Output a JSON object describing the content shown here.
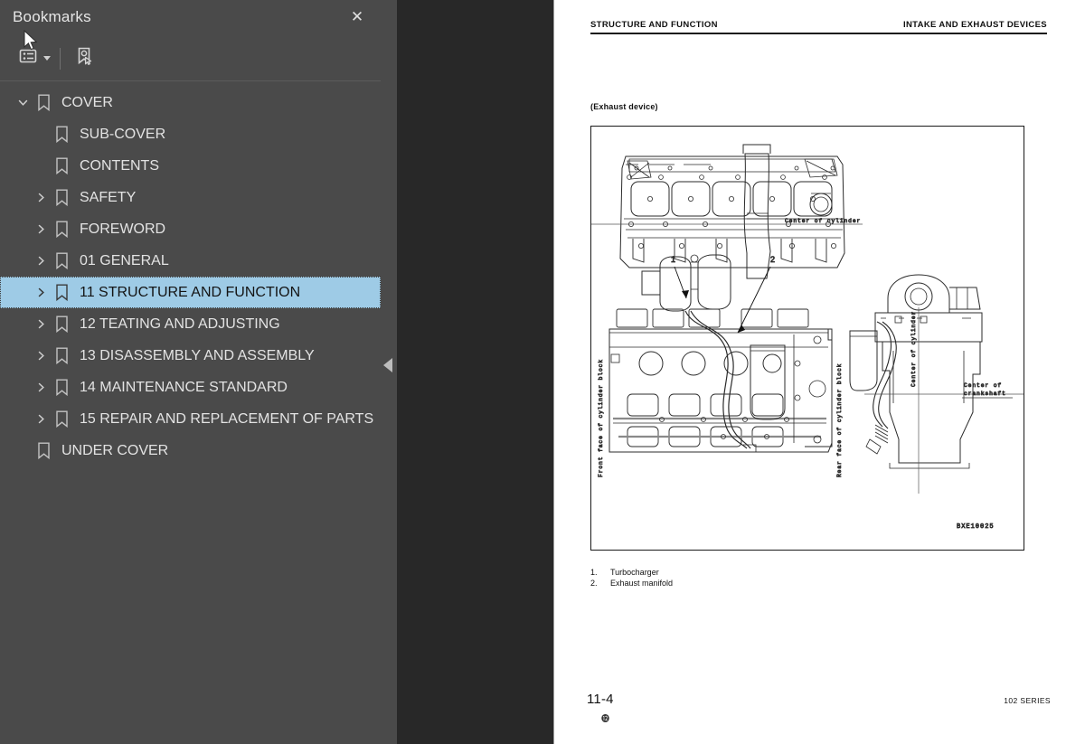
{
  "sidebar": {
    "title": "Bookmarks",
    "close_label": "✕",
    "toolbar": {
      "options_icon": "list-options-icon",
      "options_caret": "chevron-down-icon",
      "new_bookmark_icon": "new-bookmark-icon"
    },
    "items": [
      {
        "label": "COVER",
        "depth": 0,
        "twisty": "down",
        "selected": false
      },
      {
        "label": "SUB-COVER",
        "depth": 1,
        "twisty": "none",
        "selected": false
      },
      {
        "label": "CONTENTS",
        "depth": 1,
        "twisty": "none",
        "selected": false
      },
      {
        "label": "SAFETY",
        "depth": 1,
        "twisty": "right",
        "selected": false
      },
      {
        "label": "FOREWORD",
        "depth": 1,
        "twisty": "right",
        "selected": false
      },
      {
        "label": "01 GENERAL",
        "depth": 1,
        "twisty": "right",
        "selected": false
      },
      {
        "label": "11 STRUCTURE AND FUNCTION",
        "depth": 1,
        "twisty": "right",
        "selected": true
      },
      {
        "label": "12 TEATING AND ADJUSTING",
        "depth": 1,
        "twisty": "right",
        "selected": false
      },
      {
        "label": "13 DISASSEMBLY AND ASSEMBLY",
        "depth": 1,
        "twisty": "right",
        "selected": false
      },
      {
        "label": "14 MAINTENANCE STANDARD",
        "depth": 1,
        "twisty": "right",
        "selected": false
      },
      {
        "label": "15 REPAIR AND REPLACEMENT OF PARTS",
        "depth": 1,
        "twisty": "right",
        "selected": false
      },
      {
        "label": "UNDER COVER",
        "depth": 0,
        "twisty": "none",
        "selected": false
      }
    ]
  },
  "splitter": {
    "collapse_icon": "collapse-left-icon"
  },
  "page": {
    "header_left": "STRUCTURE AND FUNCTION",
    "header_right": "INTAKE AND EXHAUST DEVICES",
    "figure_caption": "(Exhaust device)",
    "figure": {
      "drawing_code": "BXE10025",
      "labels": {
        "center_of_cylinder_top": "Center of cylinder",
        "front_face": "Front face of cylinder block",
        "rear_face": "Rear face of cylinder block",
        "center_of_cylinder_side": "Center of cylinder",
        "center_of_crankshaft_l1": "Center of",
        "center_of_crankshaft_l2": "crankshaft"
      },
      "callouts": [
        "1",
        "2"
      ]
    },
    "legend": [
      {
        "num": "1.",
        "text": "Turbocharger"
      },
      {
        "num": "2.",
        "text": "Exhaust manifold"
      }
    ],
    "footer_left": "11-4",
    "footer_mark": "⓬",
    "footer_right": "102 SERIES"
  },
  "colors": {
    "sidebar_bg": "#4a4a4a",
    "viewer_bg": "#282828",
    "selection": "#9ecbe6",
    "page_bg": "#ffffff"
  }
}
